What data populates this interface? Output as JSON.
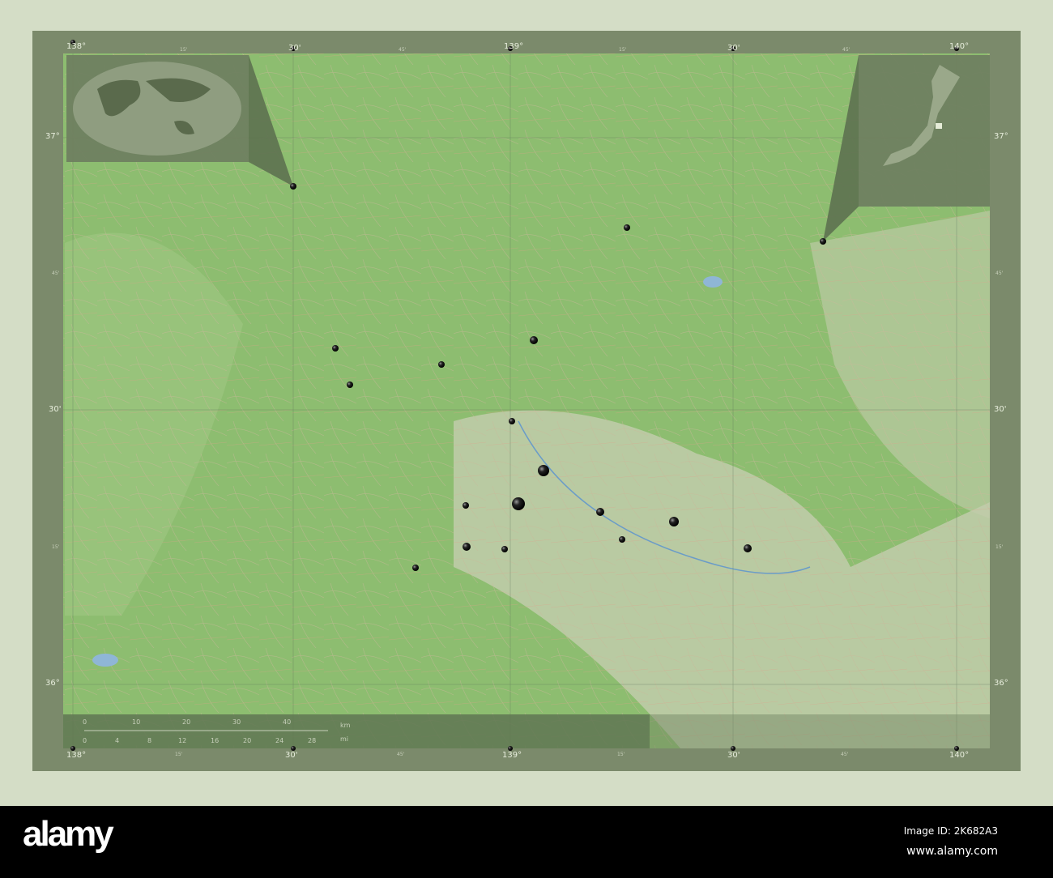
{
  "map": {
    "lon_labels": [
      "138°",
      "15'",
      "30'",
      "45'",
      "139°",
      "15'",
      "30'",
      "45'",
      "140°"
    ],
    "lat_labels": [
      "37°",
      "45'",
      "30'",
      "15'",
      "36°"
    ],
    "scale": {
      "km_ticks": [
        "0",
        "10",
        "20",
        "30",
        "40"
      ],
      "mi_ticks": [
        "0",
        "4",
        "8",
        "12",
        "16",
        "20",
        "24",
        "28"
      ],
      "km_unit": "km",
      "mi_unit": "mi"
    },
    "colors": {
      "land": "#8fbf72",
      "frame": "#7b8a6b",
      "inset": "#6f8060",
      "dot": "#111111"
    }
  },
  "watermark": {
    "logo": "alamy",
    "image_id": "Image ID: 2K682A3",
    "site": "www.alamy.com"
  }
}
